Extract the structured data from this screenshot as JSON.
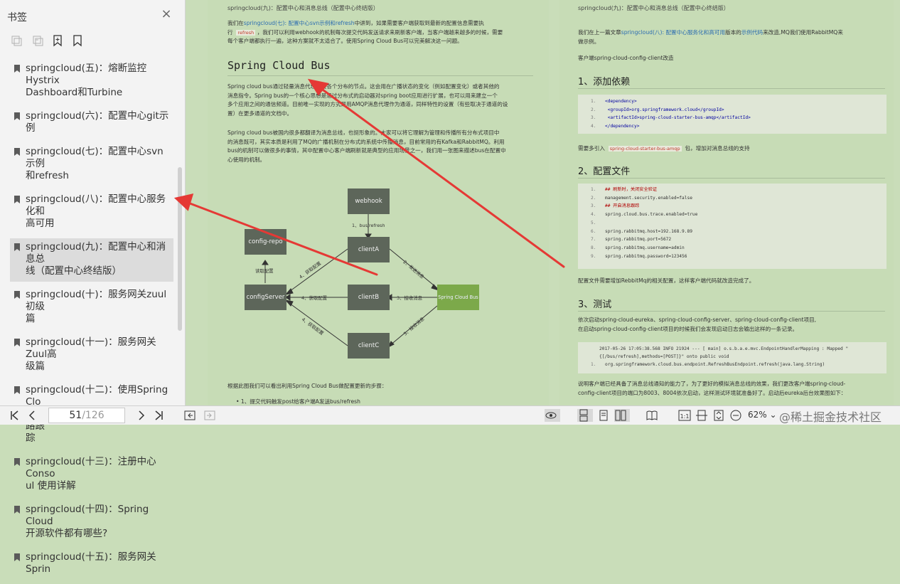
{
  "sidebar": {
    "title": "书签",
    "close_symbol": "×",
    "tools": [
      "expand-all-icon",
      "collapse-all-icon",
      "add-bookmark-icon",
      "bookmark-icon"
    ],
    "items": [
      {
        "line1": "springcloud(五)：熔断监控Hystrix",
        "line2": "Dashboard和Turbine"
      },
      {
        "line1": "springcloud(六)：配置中心git示例",
        "line2": ""
      },
      {
        "line1": "springcloud(七)：配置中心svn示例",
        "line2": "和refresh"
      },
      {
        "line1": "springcloud(八)：配置中心服务化和",
        "line2": "高可用"
      },
      {
        "line1": "springcloud(九)：配置中心和消息总",
        "line2": "线（配置中心终结版）",
        "active": true
      },
      {
        "line1": "springcloud(十)：服务网关zuul初级",
        "line2": "篇"
      },
      {
        "line1": "springcloud(十一)：服务网关Zuul高",
        "line2": "级篇"
      },
      {
        "line1": "springcloud(十二)：使用Spring Clo",
        "line2": "ud Sleuth和Zipkin进行分布式链路跟",
        "line3": "踪"
      },
      {
        "line1": "springcloud(十三)：注册中心 Conso",
        "line2": "ul 使用详解"
      },
      {
        "line1": "springcloud(十四)：Spring Cloud",
        "line2": "开源软件都有哪些?"
      },
      {
        "line1": "springcloud(十五)：服务网关 Sprin",
        "line2": ""
      }
    ]
  },
  "page_left": {
    "running_head": "springcloud(九)：配置中心和消息总线（配置中心终结版）",
    "intro_a": "我们在",
    "intro_link": "springcloud(七): 配置中心svn示例和refresh",
    "intro_b": "中讲到，如果需要客户端获取到最新的配置信息需要执",
    "intro_c": "行",
    "intro_code": "refresh",
    "intro_d": "，我们可以利用webhook的机制每次提交代码发送请求来刷新客户端，当客户端越来越多的时候，需要",
    "intro_e": "每个客户端都执行一遍，这种方案就不太适合了。使用Spring Cloud Bus可以完美解决这一问题。",
    "heading": "Spring Cloud Bus",
    "p1": [
      "Spring cloud bus通过轻量消息代理连接各个分布的节点。这会用在广播状态的变化（例如配置变化）或者其他的",
      "消息指令。Spring bus的一个核心思想是通过分布式的启动器对spring boot应用进行扩展，也可以用来建立一个",
      "多个应用之间的通信频道。目前唯一实现的方式是用AMQP消息代理作为通道，同样特性的设置（有些取决于通道的设",
      "置）在更多通道的文档中。"
    ],
    "p2": [
      "Spring cloud bus被国内很多都翻译为消息总线，也挺形象的。大家可以将它理解为管理和传播所有分布式项目中",
      "的消息既可，其实本质是利用了MQ的广播机制在分布式的系统中传播消息，目前常用的有Kafka和RabbitMQ。利用",
      "bus的机制可以做很多的事情，其中配置中心客户端刷新就是典型的应用场景之一，我们用一张图来描述bus在配置中",
      "心使用的机制。"
    ],
    "diagram": {
      "webhook": "webhook",
      "config_repo": "config-repo",
      "clientA": "clientA",
      "clientB": "clientB",
      "clientC": "clientC",
      "config_server": "configServer",
      "bus": "Spring Cloud Bus",
      "l_bus_refresh": "1、bus/refresh",
      "l_fetch_cfg": "读取配置",
      "l_get_cfg_a": "4、获取配置",
      "l_get_cfg_b": "4、获取配置",
      "l_get_cfg_c": "4、获取配置",
      "l_send_msg": "2、发送消息",
      "l_recv_msg_b": "3、接收消息",
      "l_recv_msg_c": "3、接收消息"
    },
    "p3": "根据此图我们可以看出利用Spring Cloud Bus做配置更新的步骤：",
    "step1": "1、提交代码触发post给客户端A发送bus/refresh"
  },
  "page_right": {
    "running_head": "springcloud(九)：配置中心和消息总线（配置中心终结版）",
    "intro_a": "我们在上一篇文章",
    "intro_link1": "springcloud(八): 配置中心服务化和高可用",
    "intro_b": "版本的",
    "intro_link2": "示例代码",
    "intro_c": "来改造,MQ我们使用RabbitMQ来",
    "intro_d": "做示例。",
    "client_title": "客户端spring-cloud-config-client改造",
    "h_dep": "1、添加依赖",
    "dep_lines": [
      "<dependency>",
      "    <groupId>org.springframework.cloud</groupId>",
      "    <artifactId>spring-cloud-starter-bus-amqp</artifactId>",
      "</dependency>"
    ],
    "dep_note_a": "需要多引入",
    "dep_note_code": "spring-cloud-starter-bus-amqp",
    "dep_note_b": "包，增加对消息总线的支持",
    "h_cfg": "2、配置文件",
    "cfg_lines": [
      {
        "t": "## 刷新时，关闭安全验证",
        "c": "cm"
      },
      {
        "t": "management.security.enabled=false",
        "c": ""
      },
      {
        "t": "## 开启消息跟踪",
        "c": "cm"
      },
      {
        "t": "spring.cloud.bus.trace.enabled=true",
        "c": ""
      },
      {
        "t": "",
        "c": ""
      },
      {
        "t": "spring.rabbitmq.host=192.168.9.89",
        "c": ""
      },
      {
        "t": "spring.rabbitmq.port=5672",
        "c": ""
      },
      {
        "t": "spring.rabbitmq.username=admin",
        "c": ""
      },
      {
        "t": "spring.rabbitmq.password=123456",
        "c": ""
      }
    ],
    "cfg_note": "配置文件需要增加RebbitMq的相关配置，这样客户端代码就改造完成了。",
    "h_test": "3、测试",
    "test_p1": "依次启动spring-cloud-eureka、spring-cloud-config-server、spring-cloud-config-client项目,",
    "test_p2": "在启动spring-cloud-config-client项目的时候我们会发现启动日志会输出这样的一条记录。",
    "log_a": "2017-05-26 17:05:38.568  INFO 21924 --- [           main] o.s.b.a.e.mvc.EndpointHandlerMapping     : Mapped \"",
    "log_b": "{[/bus/refresh],methods=[POST]}\" onto public void",
    "log_c": "org.springframework.cloud.bus.endpoint.RefreshBusEndpoint.refresh(java.lang.String)",
    "final_p1": "说明客户端已经具备了消息总线通知的能力了，为了更好的模拟消息总线的效果，我们更改客户端spring-cloud-",
    "final_p2": "config-client项目的端口为8003、8004依次启动，这样测试环境就准备好了。启动后eureka后台效果图如下："
  },
  "toolbar": {
    "page_current": "51",
    "page_total": "/126",
    "zoom": "62%",
    "watermark": "@稀土掘金技术社区"
  }
}
